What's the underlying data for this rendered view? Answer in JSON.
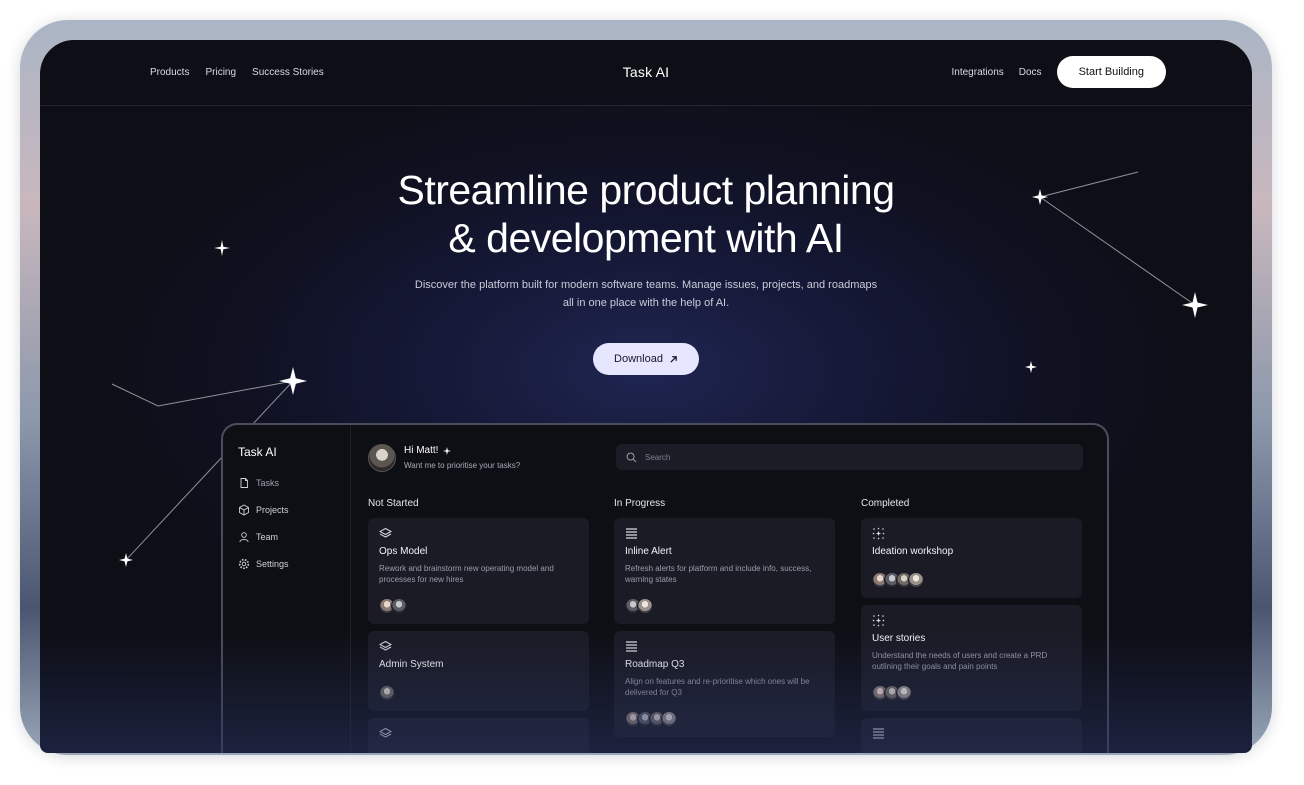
{
  "nav": {
    "left_links": [
      "Products",
      "Pricing",
      "Success Stories"
    ],
    "brand": "Task AI",
    "right_links": [
      "Integrations",
      "Docs"
    ],
    "cta": "Start Building"
  },
  "hero": {
    "title_line1": "Streamline product planning",
    "title_line2": "& development with AI",
    "subtitle": "Discover the platform built for modern software teams. Manage issues, projects, and roadmaps all in one place with the help of AI.",
    "download_label": "Download"
  },
  "app": {
    "brand": "Task AI",
    "sidebar": [
      {
        "label": "Tasks",
        "icon": "document-icon"
      },
      {
        "label": "Projects",
        "icon": "cube-icon"
      },
      {
        "label": "Team",
        "icon": "user-icon"
      },
      {
        "label": "Settings",
        "icon": "gear-icon"
      }
    ],
    "greeting": "Hi Matt!",
    "greeting_sub": "Want me to prioritise your tasks?",
    "search_placeholder": "Search",
    "columns": [
      {
        "title": "Not Started",
        "cards": [
          {
            "icon": "layers-icon",
            "title": "Ops Model",
            "desc": "Rework and brainstorm new operating model and processes for new hires",
            "avatars": 2
          },
          {
            "icon": "layers-icon",
            "title": "Admin System",
            "desc": "",
            "avatars": 1
          },
          {
            "icon": "layers-icon",
            "title": "",
            "desc": "",
            "avatars": 0
          }
        ]
      },
      {
        "title": "In Progress",
        "cards": [
          {
            "icon": "list-icon",
            "title": "Inline Alert",
            "desc": "Refresh alerts for platform and include info, success, warning states",
            "avatars": 2
          },
          {
            "icon": "list-icon",
            "title": "Roadmap Q3",
            "desc": "Align on features and re-prioritise which ones will be delivered for Q3",
            "avatars": 4
          }
        ]
      },
      {
        "title": "Completed",
        "cards": [
          {
            "icon": "sparkle-icon",
            "title": "Ideation workshop",
            "desc": "",
            "avatars": 4
          },
          {
            "icon": "sparkle-icon",
            "title": "User stories",
            "desc": "Understand the needs of users and create a PRD outlining their goals and pain points",
            "avatars": 3
          },
          {
            "icon": "list-icon",
            "title": "",
            "desc": "",
            "avatars": 0
          }
        ]
      }
    ]
  }
}
